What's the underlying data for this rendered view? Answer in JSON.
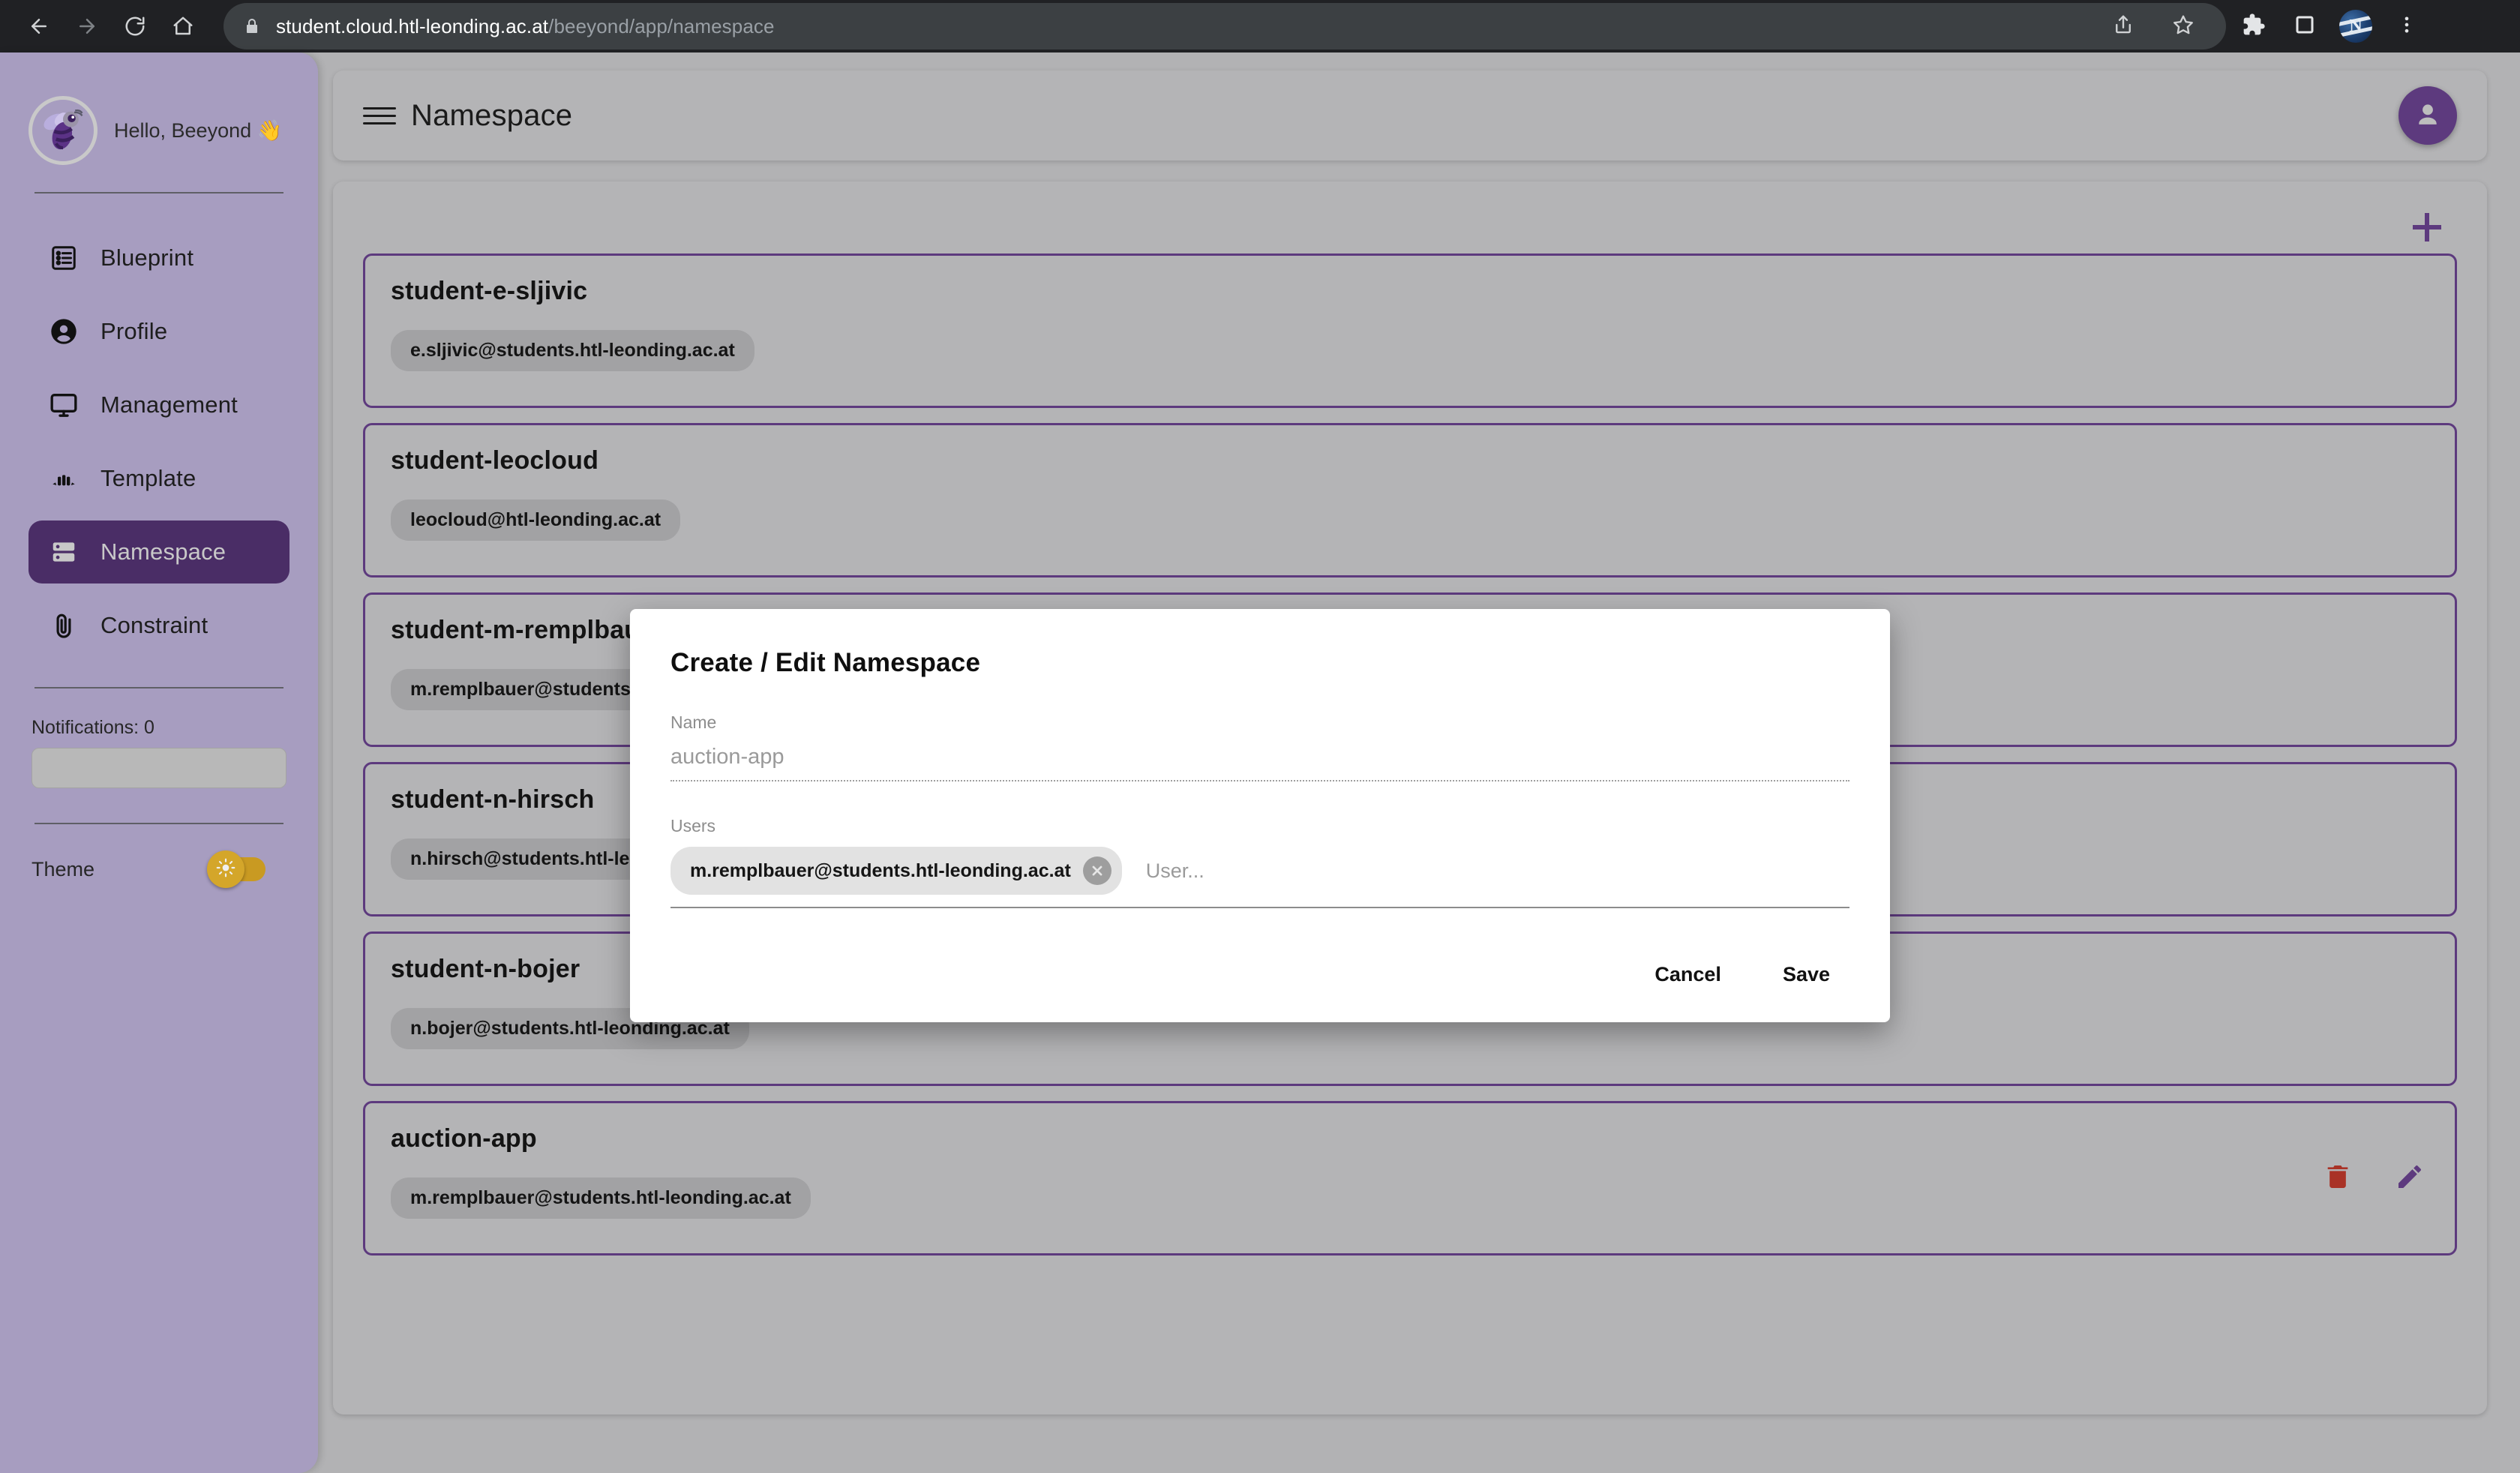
{
  "browser": {
    "back_icon": "back-arrow-icon",
    "forward_icon": "forward-arrow-icon",
    "reload_icon": "reload-icon",
    "home_icon": "home-icon",
    "lock_icon": "lock-icon",
    "url_domain": "student.cloud.htl-leonding.ac.at",
    "url_path": "/beeyond/app/namespace",
    "share_icon": "share-icon",
    "bookmark_icon": "star-icon",
    "extensions_icon": "puzzle-piece-icon",
    "sidepanel_icon": "side-panel-icon",
    "profile_initial": "N",
    "menu_icon": "three-dot-menu-icon"
  },
  "sidebar": {
    "logo_icon": "bee-logo-icon",
    "greeting": "Hello, Beeyond 👋",
    "items": [
      {
        "label": "Blueprint",
        "icon": "list-box-icon",
        "active": false
      },
      {
        "label": "Profile",
        "icon": "person-icon",
        "active": false
      },
      {
        "label": "Management",
        "icon": "monitor-icon",
        "active": false
      },
      {
        "label": "Template",
        "icon": "template-icon",
        "active": false
      },
      {
        "label": "Namespace",
        "icon": "server-icon",
        "active": true
      },
      {
        "label": "Constraint",
        "icon": "paperclip-icon",
        "active": false
      }
    ],
    "notifications_label": "Notifications: 0",
    "theme_label": "Theme",
    "theme_icon": "sun-icon"
  },
  "header": {
    "menu_icon": "hamburger-menu-icon",
    "title": "Namespace",
    "avatar_icon": "account-circle-icon"
  },
  "content": {
    "add_icon": "plus-icon",
    "delete_icon": "trash-icon",
    "edit_icon": "pencil-icon",
    "cards": [
      {
        "name": "student-e-sljivic",
        "user": "e.sljivic@students.htl-leonding.ac.at",
        "actions": false
      },
      {
        "name": "student-leocloud",
        "user": "leocloud@htl-leonding.ac.at",
        "actions": false
      },
      {
        "name": "student-m-remplbauer",
        "user": "m.remplbauer@students.htl-leonding.ac.at",
        "actions": false
      },
      {
        "name": "student-n-hirsch",
        "user": "n.hirsch@students.htl-leonding.ac.at",
        "actions": false
      },
      {
        "name": "student-n-bojer",
        "user": "n.bojer@students.htl-leonding.ac.at",
        "actions": false
      },
      {
        "name": "auction-app",
        "user": "m.remplbauer@students.htl-leonding.ac.at",
        "actions": true
      }
    ]
  },
  "dialog": {
    "title": "Create / Edit Namespace",
    "name_label": "Name",
    "name_value": "auction-app",
    "users_label": "Users",
    "user_chip": "m.remplbauer@students.htl-leonding.ac.at",
    "chip_remove_icon": "close-circle-icon",
    "user_placeholder": "User...",
    "cancel_label": "Cancel",
    "save_label": "Save"
  },
  "colors": {
    "accent_purple": "#5d3a7e",
    "sidebar_bg": "#a79dc0",
    "active_nav": "#4a2d66",
    "delete_red": "#a93226",
    "theme_gold": "#d4a62a"
  }
}
